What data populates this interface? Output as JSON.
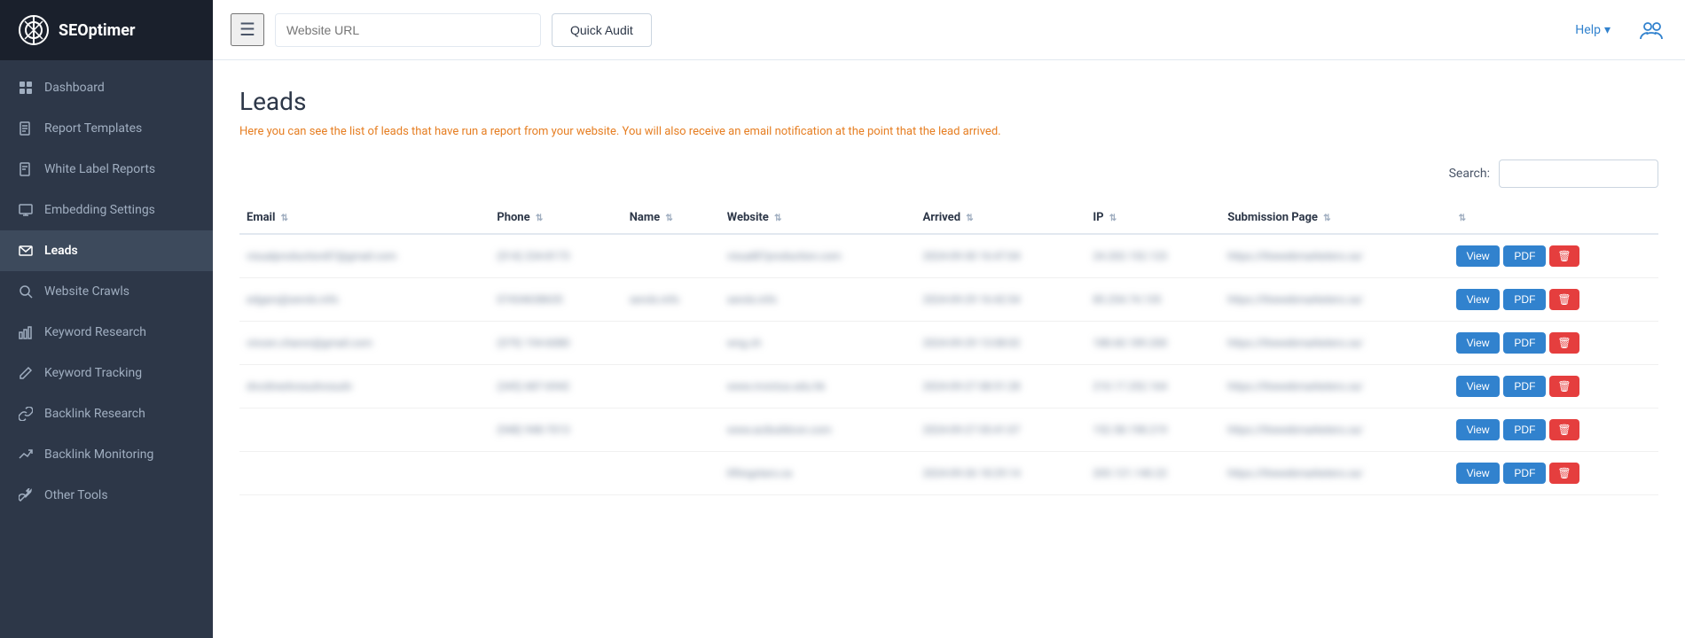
{
  "sidebar": {
    "logo_text": "SEOptimer",
    "items": [
      {
        "id": "dashboard",
        "label": "Dashboard",
        "icon": "grid"
      },
      {
        "id": "report-templates",
        "label": "Report Templates",
        "icon": "file-text"
      },
      {
        "id": "white-label-reports",
        "label": "White Label Reports",
        "icon": "file"
      },
      {
        "id": "embedding-settings",
        "label": "Embedding Settings",
        "icon": "monitor"
      },
      {
        "id": "leads",
        "label": "Leads",
        "icon": "mail",
        "active": true
      },
      {
        "id": "website-crawls",
        "label": "Website Crawls",
        "icon": "search"
      },
      {
        "id": "keyword-research",
        "label": "Keyword Research",
        "icon": "bar-chart"
      },
      {
        "id": "keyword-tracking",
        "label": "Keyword Tracking",
        "icon": "edit"
      },
      {
        "id": "backlink-research",
        "label": "Backlink Research",
        "icon": "link"
      },
      {
        "id": "backlink-monitoring",
        "label": "Backlink Monitoring",
        "icon": "trending-up"
      },
      {
        "id": "other-tools",
        "label": "Other Tools",
        "icon": "tool"
      }
    ]
  },
  "header": {
    "url_placeholder": "Website URL",
    "quick_audit_label": "Quick Audit",
    "help_label": "Help",
    "help_dropdown": "▾"
  },
  "page": {
    "title": "Leads",
    "description": "Here you can see the list of leads that have run a report from your website. You will also receive an email notification at the point that the lead arrived.",
    "search_label": "Search:"
  },
  "table": {
    "columns": [
      {
        "id": "email",
        "label": "Email"
      },
      {
        "id": "phone",
        "label": "Phone"
      },
      {
        "id": "name",
        "label": "Name"
      },
      {
        "id": "website",
        "label": "Website"
      },
      {
        "id": "arrived",
        "label": "Arrived"
      },
      {
        "id": "ip",
        "label": "IP"
      },
      {
        "id": "submission_page",
        "label": "Submission Page"
      }
    ],
    "rows": [
      {
        "email": "visualproduction87@gmail.com",
        "phone": "(514) 234-8173",
        "name": "",
        "website": "visual87production.com",
        "arrived": "2024-09-30 16:47:04",
        "ip": "24.202.152.123",
        "submission_page": "https://thewebmarketers.ca/"
      },
      {
        "email": "edgars@serols.info",
        "phone": "07434638635",
        "name": "serols.info",
        "website": "serols.info",
        "arrived": "2024-09-29 16:42:54",
        "ip": "85.254.74.135",
        "submission_page": "https://thewebmarketers.ca/"
      },
      {
        "email": "vincen.charon@gmail.com",
        "phone": "(579) 194-6080",
        "name": "",
        "website": "wng.ch",
        "arrived": "2024-09-29 13:08:02",
        "ip": "188.60.189.200",
        "submission_page": "https://thewebmarketers.ca/"
      },
      {
        "email": "dncdinedvosudvosudv",
        "phone": "(345) 687-6942",
        "name": "",
        "website": "www.mvictus.edu.hk",
        "arrived": "2024-09-27 08:51:28",
        "ip": "210.17.252.164",
        "submission_page": "https://thewebmarketers.ca/"
      },
      {
        "email": "",
        "phone": "(948) 948-7013",
        "name": "",
        "website": "www.acibuildcon.com",
        "arrived": "2024-09-27 05:41:07",
        "ip": "152.58.198.219",
        "submission_page": "https://thewebmarketers.ca/"
      },
      {
        "email": "",
        "phone": "",
        "name": "",
        "website": "liftingstars.ca",
        "arrived": "2024-09-26 18:29:14",
        "ip": "205.121.140.22",
        "submission_page": "https://thewebmarketers.ca/"
      }
    ],
    "view_label": "View",
    "pdf_label": "PDF",
    "delete_label": "🗑"
  }
}
